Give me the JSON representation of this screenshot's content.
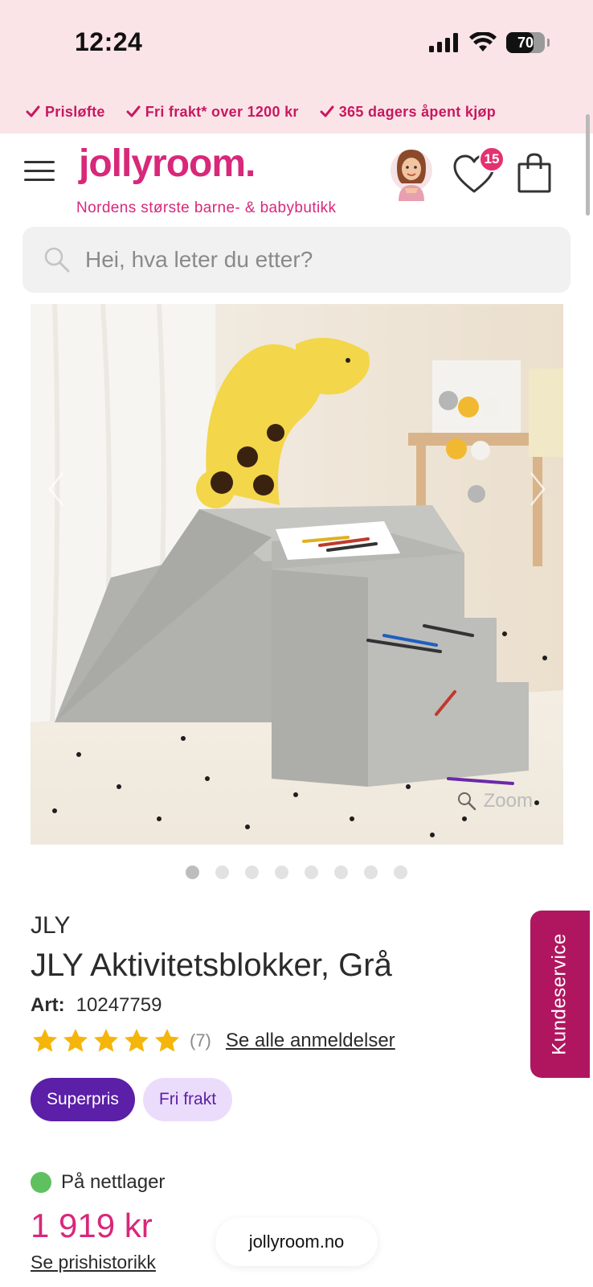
{
  "status_bar": {
    "time": "12:24",
    "battery": "70",
    "battery_level": 0.7
  },
  "usp": [
    {
      "label": "Prisløfte"
    },
    {
      "label": "Fri frakt* over 1200 kr"
    },
    {
      "label": "365 dagers åpent kjøp"
    }
  ],
  "header": {
    "logo": "jollyroom.",
    "tagline": "Nordens største barne- & babybutikk",
    "wishlist_count": "15"
  },
  "search": {
    "placeholder": "Hei, hva leter du etter?"
  },
  "product_image": {
    "zoom_label": "Zoom",
    "total_images": 8,
    "active_index": 0
  },
  "product": {
    "brand": "JLY",
    "title": "JLY Aktivitetsblokker, Grå",
    "art_label": "Art:",
    "art_number": "10247759",
    "rating": 5,
    "review_count": "(7)",
    "review_link": "Se alle anmeldelser",
    "badges": [
      "Superpris",
      "Fri frakt"
    ],
    "stock": "På nettlager",
    "price": "1 919 kr",
    "price_history": "Se prishistorikk"
  },
  "customer_service": "Kundeservice",
  "url": "jollyroom.no",
  "colors": {
    "brand_pink": "#d8287a",
    "usp_bg": "#fbe4e8",
    "super_purple": "#5b1fa8",
    "free_lilac": "#ecdcfb",
    "stock_green": "#5fc05f",
    "kundeservice_bg": "#b0165f"
  }
}
